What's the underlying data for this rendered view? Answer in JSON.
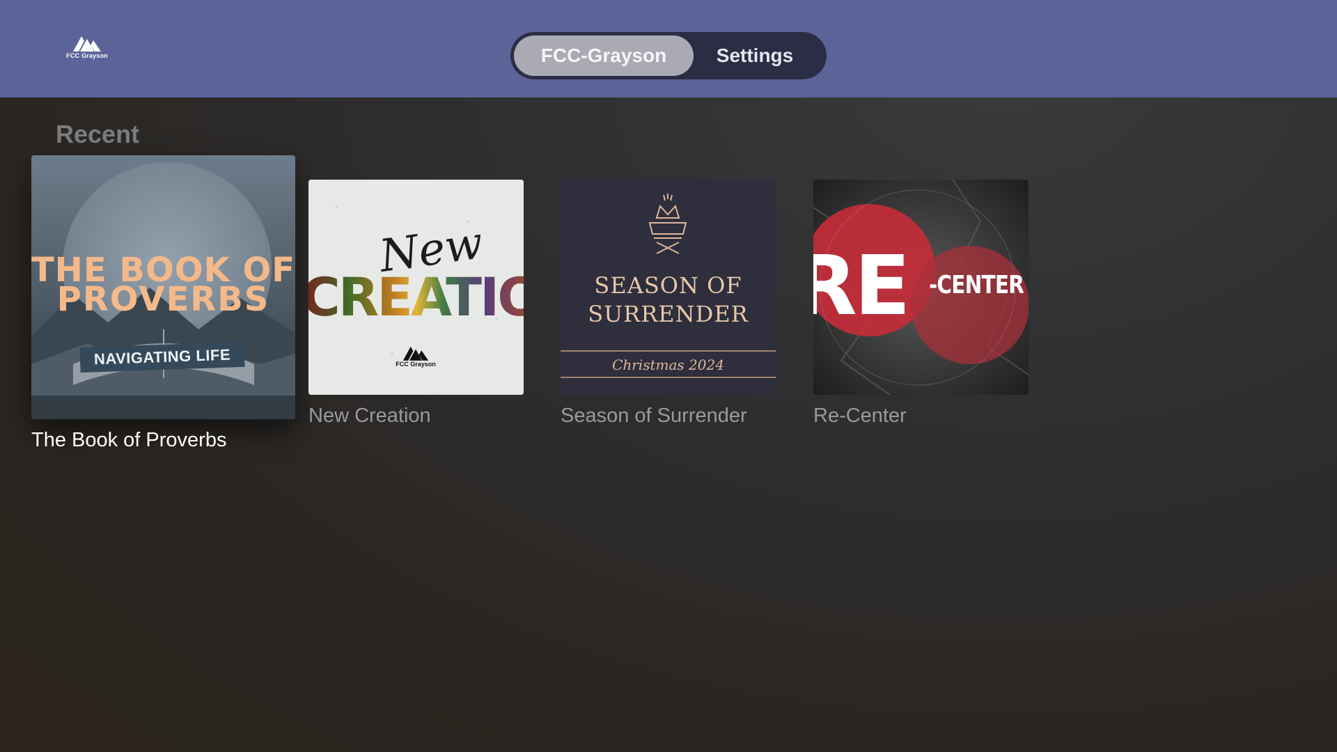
{
  "app": {
    "logo_text": "FCC Grayson"
  },
  "nav": {
    "tabs": [
      {
        "label": "FCC-Grayson",
        "selected": true
      },
      {
        "label": "Settings",
        "selected": false
      }
    ]
  },
  "recent": {
    "title": "Recent",
    "items": [
      {
        "title": "The Book of Proverbs",
        "focused": true,
        "artwork": {
          "line1": "THE BOOK OF",
          "line2": "PROVERBS",
          "banner": "NAVIGATING LIFE"
        }
      },
      {
        "title": "New Creation",
        "focused": false,
        "artwork": {
          "script": "New",
          "word": "CREATION",
          "logo_text": "FCC Grayson"
        }
      },
      {
        "title": "Season of Surrender",
        "focused": false,
        "artwork": {
          "line1": "SEASON OF",
          "line2": "SURRENDER",
          "script": "Christmas 2024"
        }
      },
      {
        "title": "Re-Center",
        "focused": false,
        "artwork": {
          "big": "RE",
          "small": "-CENTER"
        }
      }
    ]
  },
  "colors": {
    "topbar": "#5c6399",
    "tab_track": "#2b2d45",
    "tab_selected": "#a9aab3",
    "proverbs_accent": "#f4b98a",
    "surrender_accent": "#e9c9a8",
    "recenter_red": "#c42d3a"
  }
}
